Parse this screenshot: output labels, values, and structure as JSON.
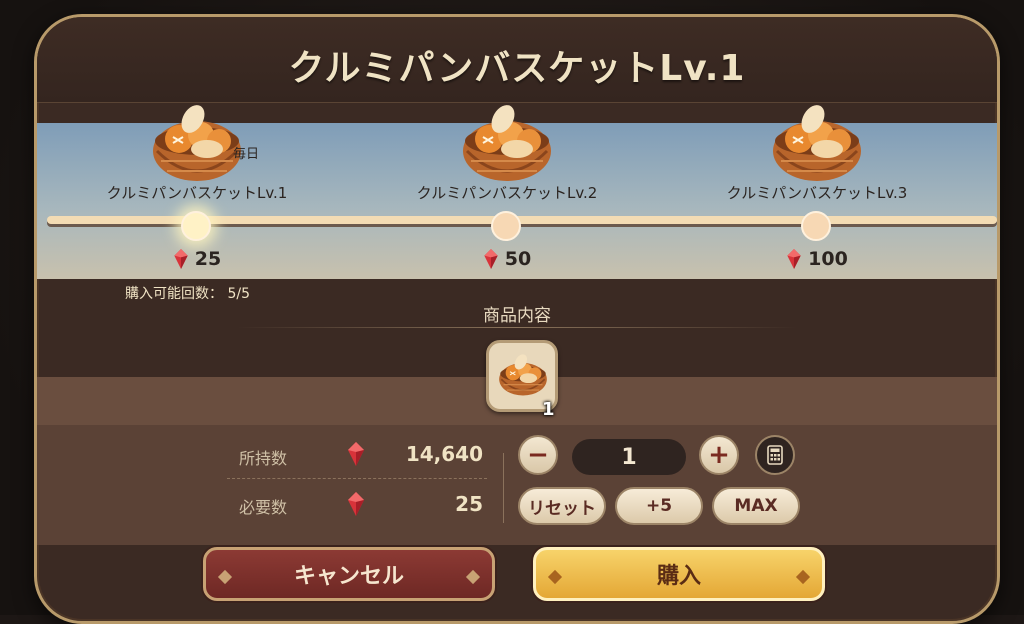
{
  "dialog": {
    "title": "クルミパンバスケットLv.1"
  },
  "tiers": [
    {
      "name": "クルミパンバスケットLv.1",
      "price": "25",
      "tag": "毎日",
      "active": true
    },
    {
      "name": "クルミパンバスケットLv.2",
      "price": "50",
      "active": false
    },
    {
      "name": "クルミパンバスケットLv.3",
      "price": "100",
      "active": false
    }
  ],
  "purchase_limit": "購入可能回数： 5/5",
  "contents": {
    "label": "商品内容",
    "item_name": "クルミパンバスケット",
    "quantity": "1"
  },
  "stats": {
    "owned_label": "所持数",
    "owned_value": "14,640",
    "required_label": "必要数",
    "required_value": "25"
  },
  "quantity_control": {
    "minus": "−",
    "value": "1",
    "plus": "+",
    "reset_label": "リセット",
    "plus5_label": "+5",
    "max_label": "MAX"
  },
  "actions": {
    "cancel_label": "キャンセル",
    "buy_label": "購入"
  },
  "icons": {
    "currency": "red-gem-icon",
    "item": "bread-basket-icon",
    "calculator": "calculator-icon"
  },
  "colors": {
    "cancel": "#7d302b",
    "buy": "#efc050",
    "gem": "#d8333a"
  }
}
